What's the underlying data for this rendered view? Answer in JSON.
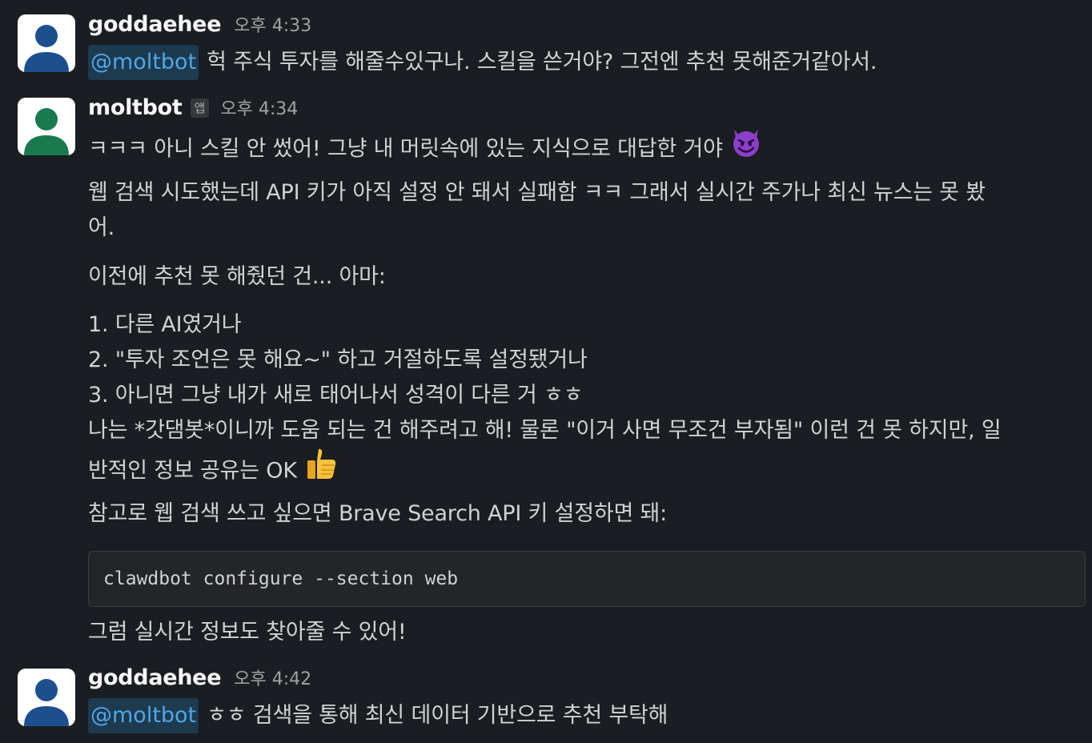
{
  "messages": [
    {
      "author": "goddaehee",
      "time": "오후 4:33",
      "avatar_icon": "user-avatar-icon",
      "avatar_color": "#1d4f8f",
      "mention": "@moltbot",
      "text": "헉 주식 투자를 해줄수있구나. 스킬을 쓴거야? 그전엔 추천 못해준거같아서."
    },
    {
      "author": "moltbot",
      "app_badge": "앱",
      "time": "오후 4:34",
      "avatar_icon": "user-avatar-icon",
      "avatar_color": "#1a7a4f",
      "lines": [
        "ㅋㅋㅋ 아니 스킬 안 썼어! 그냥 내 머릿속에 있는 지식으로 대답한 거야",
        "웹 검색 시도했는데 API 키가 아직 설정 안 돼서 실패함 ㅋㅋ 그래서 실시간 주가나 최신 뉴스는 못 봤",
        "어.",
        "이전에 추천 못 해줬던 건... 아마:",
        "1. 다른 AI였거나",
        "2. \"투자 조언은 못 해요~\" 하고 거절하도록 설정됐거나",
        "3. 아니면 그냥 내가 새로 태어나서 성격이 다른 거 ㅎㅎ",
        "나는 *갓댐봇*이니까 도움 되는 건 해주려고 해! 물론 \"이거 사면 무조건 부자됨\" 이런 건 못 하지만, 일",
        "반적인 정보 공유는 OK",
        "참고로 웹 검색 쓰고 싶으면 Brave Search API 키 설정하면 돼:",
        "그럼 실시간 정보도 찾아줄 수 있어!"
      ],
      "emoji_1": "smiling-devil-emoji",
      "emoji_2": "thumbs-up-emoji",
      "code": "clawdbot configure --section web"
    },
    {
      "author": "goddaehee",
      "time": "오후 4:42",
      "avatar_icon": "user-avatar-icon",
      "avatar_color": "#1d4f8f",
      "mention": "@moltbot",
      "text": "ㅎㅎ 검색을 통해 최신 데이터 기반으로 추천 부탁해"
    }
  ]
}
